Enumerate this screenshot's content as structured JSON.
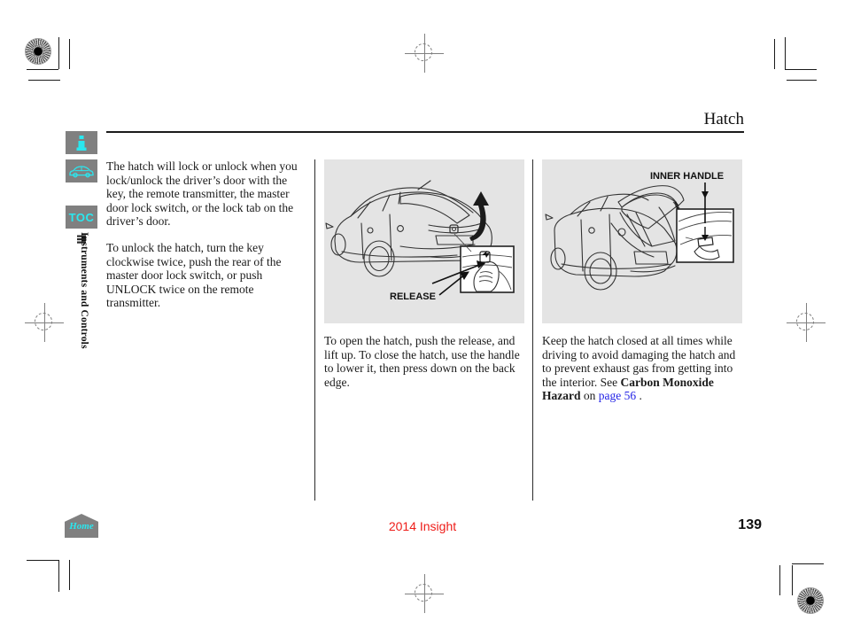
{
  "document": {
    "title": "Hatch",
    "model": "2014 Insight",
    "page_number": "139",
    "section_label": "Instruments and Controls"
  },
  "sidebar": {
    "items": [
      {
        "name": "info-icon",
        "label": "i",
        "type": "icon"
      },
      {
        "name": "car-icon",
        "label": "",
        "type": "icon"
      },
      {
        "name": "toc-button",
        "label": "TOC",
        "type": "text"
      }
    ],
    "home_button": {
      "label": "Home"
    }
  },
  "columns": {
    "text_column": {
      "paragraphs": [
        "The hatch will lock or unlock when you lock/unlock the driver’s door with the key, the remote transmitter, the master door lock switch, or the lock tab on the driver’s door.",
        "To unlock the hatch, turn the key clockwise twice, push the rear of the master door lock switch, or push UNLOCK twice on the remote transmitter."
      ]
    },
    "middle_column": {
      "illustration": {
        "name": "hatch-release-illustration",
        "callout": "RELEASE",
        "description": "Rear three-quarter view of the vehicle with the hatch lifting upward, an arrow showing the opening direction, and an inset of a hand pressing the release button."
      },
      "caption": "To open the hatch, push the release, and lift up. To close the hatch, use the handle to lower it, then press down on the back edge."
    },
    "right_column": {
      "illustration": {
        "name": "inner-handle-illustration",
        "callout": "INNER HANDLE",
        "description": "Rear view of the vehicle with the hatch fully open and an inset detail of the inner handle on the underside of the hatch."
      },
      "caption_parts": {
        "lead": "Keep the hatch closed at all times while driving to avoid damaging the hatch and to prevent exhaust gas from getting into the interior. See ",
        "bold_term": "Carbon Monoxide Hazard",
        "mid": " on ",
        "link": "page 56",
        "tail": " ."
      }
    }
  },
  "colors": {
    "accent_cyan": "#2ae7ef",
    "rail_gray": "#808080",
    "illustration_bg": "#e4e4e4",
    "link_blue": "#2323e6",
    "model_red": "#ee1c18"
  }
}
